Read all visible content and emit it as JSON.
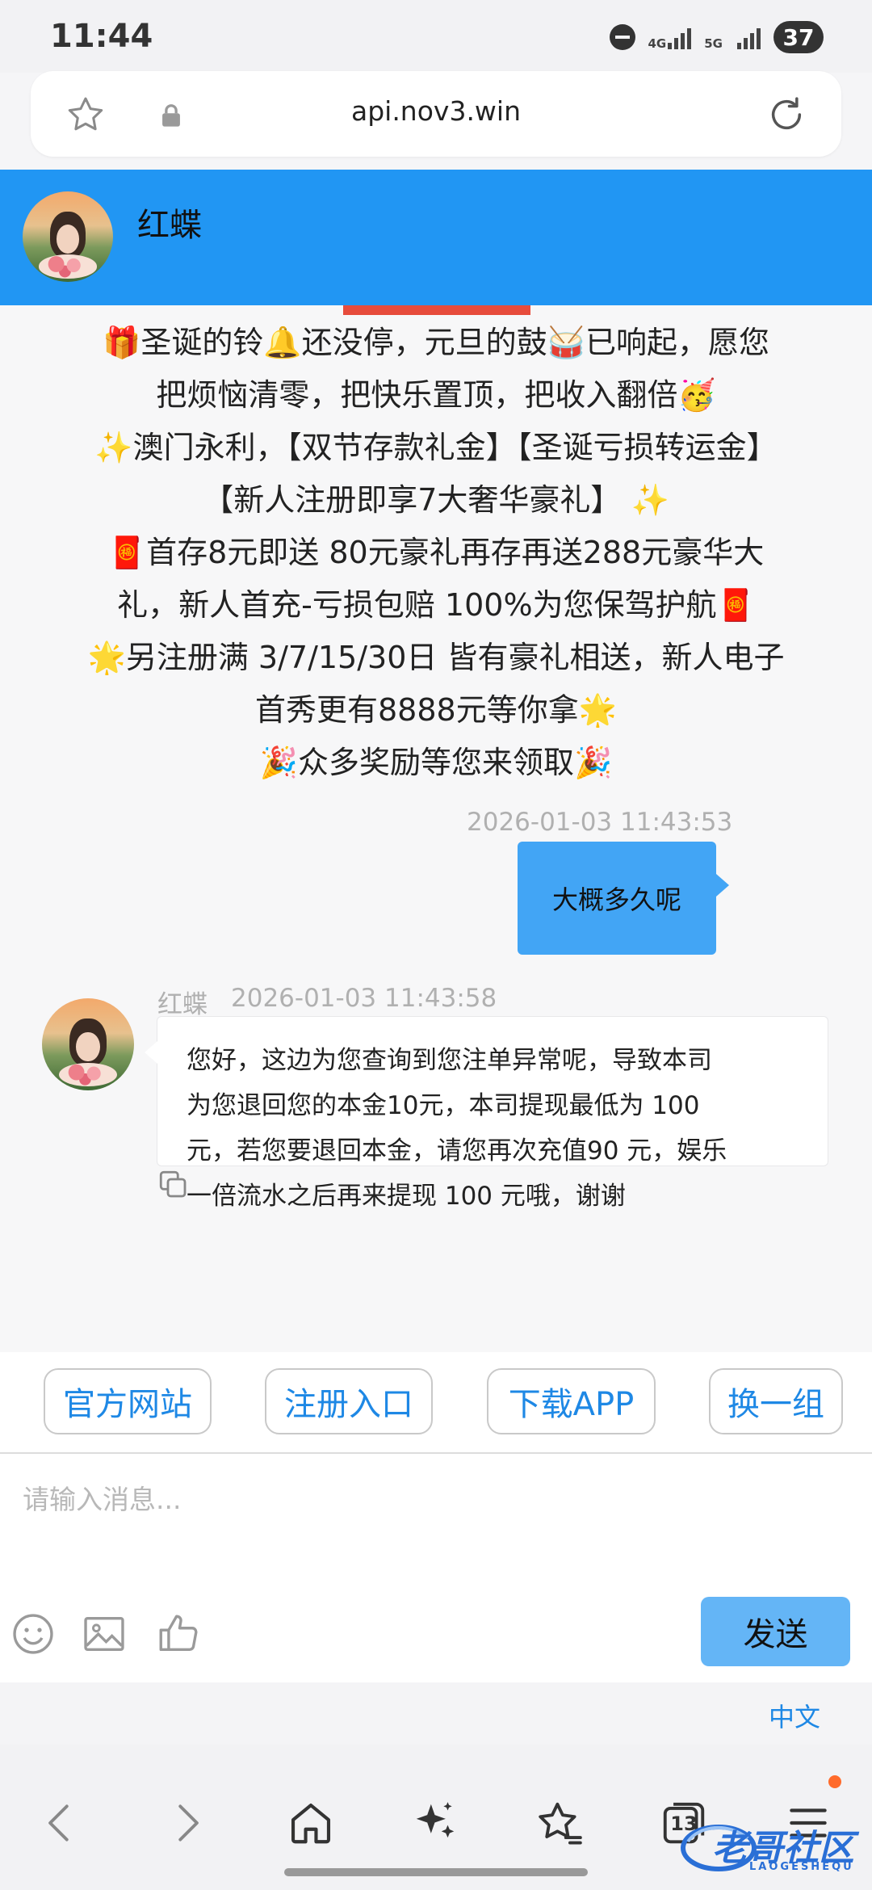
{
  "status_bar": {
    "time": "11:44",
    "net_1": "4G",
    "net_2": "5G",
    "battery": "37"
  },
  "browser": {
    "url": "api.nov3.win"
  },
  "chat_header": {
    "contact_name": "红蝶"
  },
  "promo_lines": [
    "🎁圣诞的铃🔔还没停，元旦的鼓🥁已响起，愿您",
    "把烦恼清零，把快乐置顶，把收入翻倍🥳",
    "✨澳门永利，【双节存款礼金】【圣诞亏损转运金】",
    "【新人注册即享7大奢华豪礼】 ✨",
    "🧧首存8元即送 80元豪礼再存再送288元豪华大",
    "礼，新人首充-亏损包赔 100%为您保驾护航🧧",
    "🌟另注册满 3/7/15/30日 皆有豪礼相送，新人电子",
    "首秀更有8888元等你拿🌟",
    "🎉众多奖励等您来领取🎉"
  ],
  "messages": {
    "sent": {
      "timestamp": "2026-01-03 11:43:53",
      "text": "大概多久呢"
    },
    "received": {
      "sender": "红蝶",
      "timestamp": "2026-01-03 11:43:58",
      "lines": [
        "您好，这边为您查询到您注单异常呢，导致本司",
        "为您退回您的本金10元，本司提现最低为 100",
        "元，若您要退回本金，请您再次充值90 元，娱乐",
        "一倍流水之后再来提现 100 元哦，谢谢"
      ]
    }
  },
  "quick_links": [
    "官方网站",
    "注册入口",
    "下载APP",
    "换一组"
  ],
  "composer": {
    "placeholder": "请输入消息...",
    "send_label": "发送",
    "language": "中文"
  },
  "nav": {
    "tabs_count": "13"
  },
  "watermark": {
    "text": "老哥社区",
    "sub": "LAOGESHEQU"
  },
  "colors": {
    "header_blue": "#2196f3",
    "bubble_blue": "#42a5f5",
    "send_blue": "#64b5f6",
    "link_blue": "#1e88e5"
  }
}
